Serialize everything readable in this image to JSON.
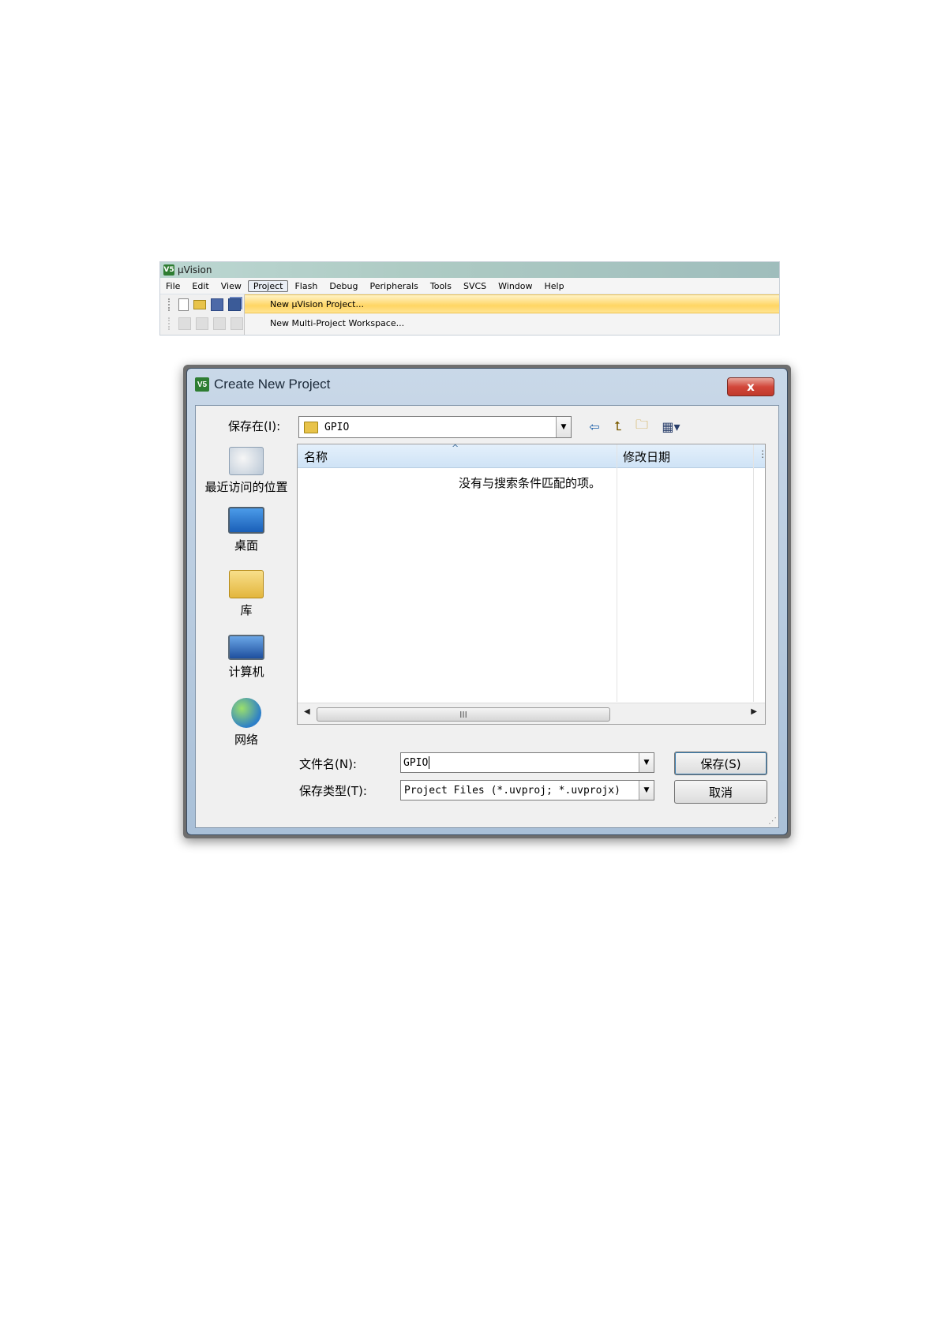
{
  "uvision": {
    "title": "μVision",
    "logo_text": "V5",
    "menu": [
      "File",
      "Edit",
      "View",
      "Project",
      "Flash",
      "Debug",
      "Peripherals",
      "Tools",
      "SVCS",
      "Window",
      "Help"
    ],
    "active_menu": "Project",
    "dropdown": {
      "items": [
        "New μVision Project...",
        "New Multi-Project Workspace..."
      ],
      "highlighted_index": 0
    },
    "toolbar_icons": [
      "new-file-icon",
      "open-folder-icon",
      "save-icon",
      "save-all-icon"
    ],
    "toolbar2_icons": [
      "build-icon",
      "rebuild-icon",
      "batch-icon",
      "stop-icon"
    ]
  },
  "dialog": {
    "title": "Create New Project",
    "logo_text": "V5",
    "close_symbol": "x",
    "save_in_label": "保存在(I):",
    "save_in_value": "GPIO",
    "nav_icons": [
      "back-icon",
      "up-folder-icon",
      "new-folder-icon",
      "view-menu-icon"
    ],
    "places": [
      {
        "label": "最近访问的位置",
        "icon": "recent-places-icon"
      },
      {
        "label": "桌面",
        "icon": "desktop-icon"
      },
      {
        "label": "库",
        "icon": "library-icon"
      },
      {
        "label": "计算机",
        "icon": "computer-icon"
      },
      {
        "label": "网络",
        "icon": "network-icon"
      }
    ],
    "list": {
      "columns": [
        "名称",
        "修改日期"
      ],
      "empty_message": "没有与搜索条件匹配的项。",
      "scroll_thumb": "III"
    },
    "file_name_label": "文件名(N):",
    "file_name_value": "GPIO",
    "file_type_label": "保存类型(T):",
    "file_type_value": "Project Files (*.uvproj; *.uvprojx)",
    "save_button": "保存(S)",
    "cancel_button": "取消"
  }
}
